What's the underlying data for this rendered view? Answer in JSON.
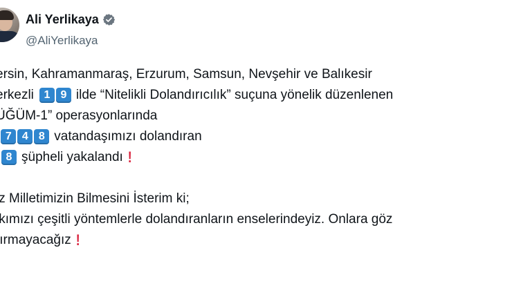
{
  "author": {
    "display_name": "Ali Yerlikaya",
    "handle": "@AliYerlikaya"
  },
  "icons": {
    "verified": "verified-badge-icon",
    "exclamation": "red-exclamation-icon"
  },
  "colors": {
    "keycap": "#2f86cf",
    "exclamation": "#d91f3a",
    "handle": "#536471"
  },
  "tweet": {
    "line1": "ersin, Kahramanmaraş, Erzurum, Samsun, Nevşehir ve Balıkesir",
    "line2_prefix": "erkezli",
    "line2_digits": [
      "1",
      "9"
    ],
    "line2_suffix": "ilde “Nitelikli Dolandırıcılık” suçuna yönelik düzenlenen",
    "line3": "ÜĞÜM-1” operasyonlarında",
    "line4_prefix": ".",
    "line4_digits": [
      "7",
      "4",
      "8"
    ],
    "line4_suffix": "vatandaşımızı dolandıran",
    "line5_digits": [
      "8"
    ],
    "line5_suffix": "şüpheli yakalandı",
    "line6": "iz Milletimizin Bilmesini İsterim ki;",
    "line7": "lkımızı çeşitli yöntemlerle dolandıranların enselerindeyiz. Onlara göz",
    "line8": "tırmayacağız",
    "exclamation_glyph": "!"
  }
}
